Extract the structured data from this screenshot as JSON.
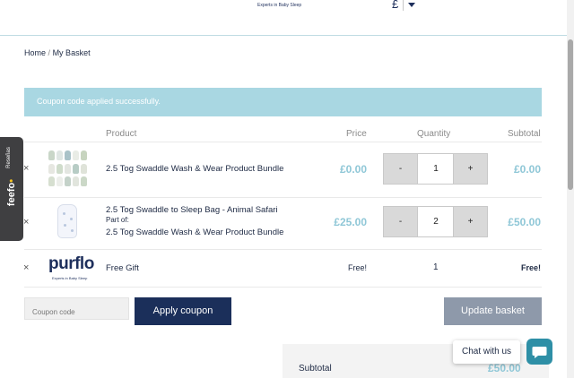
{
  "header": {
    "tagline": "Experts in Baby Sleep",
    "currency_symbol": "£"
  },
  "breadcrumb": {
    "home": "Home",
    "separator": "/",
    "current": "My Basket"
  },
  "notice": {
    "message": "Coupon code applied successfully.",
    "color": "#a9d7e2"
  },
  "table": {
    "headers": {
      "product": "Product",
      "price": "Price",
      "quantity": "Quantity",
      "subtotal": "Subtotal"
    },
    "rows": [
      {
        "remove": "×",
        "name": "2.5 Tog Swaddle Wash & Wear Product Bundle",
        "price": "£0.00",
        "minus": "-",
        "quantity": "1",
        "plus": "+",
        "subtotal": "£0.00"
      },
      {
        "remove": "×",
        "name": "2.5 Tog Swaddle to Sleep Bag - Animal Safari",
        "part_of_label": "Part of:",
        "part_of": "2.5 Tog Swaddle Wash & Wear Product Bundle",
        "price": "£25.00",
        "minus": "-",
        "quantity": "2",
        "plus": "+",
        "subtotal": "£50.00"
      },
      {
        "remove": "×",
        "logo_text": "purflo",
        "logo_sub": "Experts in Baby Sleep",
        "name": "Free Gift",
        "price": "Free!",
        "quantity": "1",
        "subtotal": "Free!"
      }
    ]
  },
  "coupon": {
    "placeholder": "Coupon code",
    "apply_label": "Apply coupon"
  },
  "update_label": "Update basket",
  "totals": {
    "subtotal_label": "Subtotal",
    "subtotal_value": "£50.00"
  },
  "chat": {
    "label": "Chat with us"
  },
  "feefo": {
    "logo": "feefo",
    "label": "Reseñas"
  },
  "colors": {
    "navy": "#1b2f5a",
    "accent": "#8fc7d7",
    "chat": "#2e8fa6"
  }
}
